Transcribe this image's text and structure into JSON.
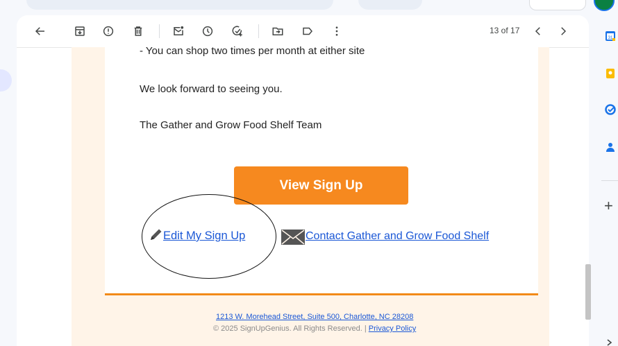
{
  "toolbar": {
    "pager": "13 of 17",
    "icons": [
      "back-arrow-icon",
      "archive-icon",
      "report-spam-icon",
      "delete-icon",
      "mark-unread-icon",
      "snooze-icon",
      "add-task-icon",
      "move-to-icon",
      "label-icon",
      "more-vert-icon",
      "chevron-left-icon",
      "chevron-right-icon"
    ]
  },
  "email": {
    "line_shop": "- You can shop two times per month at either site",
    "line_forward": "We look forward to seeing you.",
    "line_team": "The Gather and Grow Food Shelf Team",
    "cta_label": "View Sign Up",
    "edit_link": "Edit My Sign Up",
    "contact_link": "Contact Gather and Grow Food Shelf",
    "footer_address": "1213 W. Morehead Street, Suite 500, Charlotte, NC 28208",
    "footer_copyright": "© 2025 SignUpGenius. All Rights Reserved. | ",
    "footer_privacy": "Privacy Policy"
  },
  "side_panel": {
    "calendar_day": "31",
    "add_label": "+"
  },
  "colors": {
    "accent_orange": "#f6891f",
    "link_blue": "#1a57d6",
    "email_bg": "#fff4e8"
  }
}
